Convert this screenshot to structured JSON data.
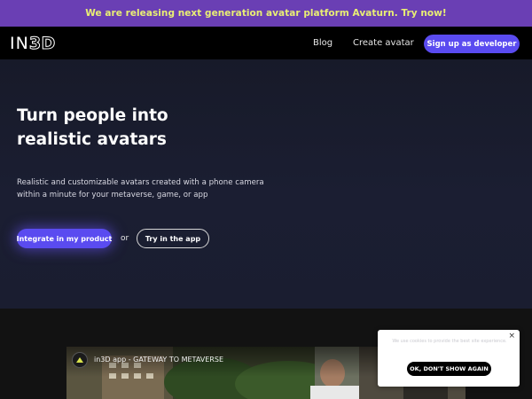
{
  "announcement": {
    "text": "We are releasing next generation avatar platform Avaturn. Try now!"
  },
  "nav": {
    "logo": {
      "part1": "IN",
      "part2": "3D"
    },
    "links": [
      "Blog",
      "Create avatar"
    ],
    "signup_label": "Sign up as developer"
  },
  "hero": {
    "title": "Turn people into realistic avatars",
    "subtitle": "Realistic and customizable avatars created with a phone camera within a minute for your metaverse, game, or app",
    "primary_button": "Integrate in my product",
    "or_text": "or",
    "secondary_button": "Try in the app"
  },
  "video": {
    "title": "in3D app - GATEWAY TO METAVERSE",
    "channel_icon": "in3d-channel-avatar-icon"
  },
  "cookie": {
    "close_glyph": "×",
    "text": "We use cookies to provide the best site experience.",
    "button": "OK, DON'T SHOW AGAIN"
  },
  "colors": {
    "announce_bg": "#6a3fb4",
    "announce_text": "#e9ef74",
    "accent": "#5a4bf0",
    "hero_bg": "#1b1e32",
    "nav_bg": "#000000"
  }
}
